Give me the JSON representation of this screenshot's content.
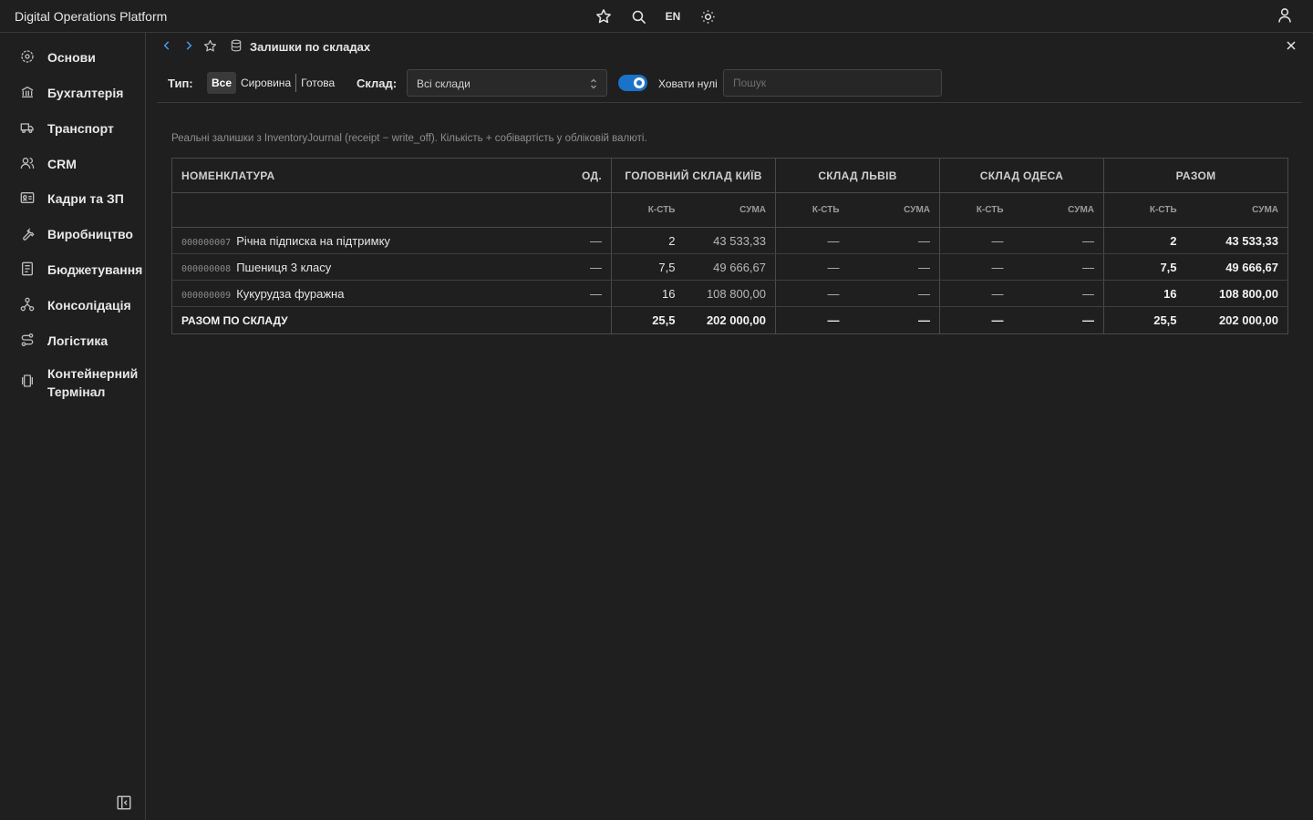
{
  "app": {
    "title": "Digital Operations Platform",
    "lang": "EN"
  },
  "sidebar": {
    "items": [
      {
        "label": "Основи",
        "icon": "settings-icon"
      },
      {
        "label": "Бухгалтерія",
        "icon": "bank-icon"
      },
      {
        "label": "Транспорт",
        "icon": "truck-icon"
      },
      {
        "label": "CRM",
        "icon": "users-icon"
      },
      {
        "label": "Кадри та ЗП",
        "icon": "id-card-icon"
      },
      {
        "label": "Виробництво",
        "icon": "wrench-icon"
      },
      {
        "label": "Бюджетування",
        "icon": "budget-icon"
      },
      {
        "label": "Консолідація",
        "icon": "network-icon"
      },
      {
        "label": "Логістика",
        "icon": "route-icon"
      },
      {
        "label": "Контейнерний Термінал",
        "icon": "container-icon"
      }
    ]
  },
  "breadcrumb": {
    "title": "Залишки по складах"
  },
  "filters": {
    "type_label": "Тип:",
    "type_options": [
      "Все",
      "Сировина",
      "Готова"
    ],
    "type_selected": "Все",
    "warehouse_label": "Склад:",
    "warehouse_value": "Всі склади",
    "hide_zeros_label": "Ховати нулі",
    "hide_zeros_on": true,
    "search_placeholder": "Пошук"
  },
  "note": "Реальні залишки з InventoryJournal (receipt − write_off). Кількість + собівартість у обліковій валюті.",
  "table": {
    "headers": {
      "item": "Номенклатура",
      "unit": "Од.",
      "wh1": "Головний склад Київ",
      "wh2": "Склад Львів",
      "wh3": "Склад Одеса",
      "total": "Разом",
      "qty": "к-сть",
      "sum": "сума"
    },
    "rows": [
      {
        "code": "000000007",
        "name": "Річна підписка на підтримку",
        "unit": "—",
        "wh1_qty": "2",
        "wh1_sum": "43 533,33",
        "wh2_qty": "—",
        "wh2_sum": "—",
        "wh3_qty": "—",
        "wh3_sum": "—",
        "tot_qty": "2",
        "tot_sum": "43 533,33"
      },
      {
        "code": "000000008",
        "name": "Пшениця 3 класу",
        "unit": "—",
        "wh1_qty": "7,5",
        "wh1_sum": "49 666,67",
        "wh2_qty": "—",
        "wh2_sum": "—",
        "wh3_qty": "—",
        "wh3_sum": "—",
        "tot_qty": "7,5",
        "tot_sum": "49 666,67"
      },
      {
        "code": "000000009",
        "name": "Кукурудза фуражна",
        "unit": "—",
        "wh1_qty": "16",
        "wh1_sum": "108 800,00",
        "wh2_qty": "—",
        "wh2_sum": "—",
        "wh3_qty": "—",
        "wh3_sum": "—",
        "tot_qty": "16",
        "tot_sum": "108 800,00"
      }
    ],
    "total_row": {
      "label": "Разом по складу",
      "wh1_qty": "25,5",
      "wh1_sum": "202 000,00",
      "wh2_qty": "—",
      "wh2_sum": "—",
      "wh3_qty": "—",
      "wh3_sum": "—",
      "tot_qty": "25,5",
      "tot_sum": "202 000,00"
    }
  },
  "colors": {
    "accent": "#1a73c8",
    "background": "#1f1f1f"
  }
}
